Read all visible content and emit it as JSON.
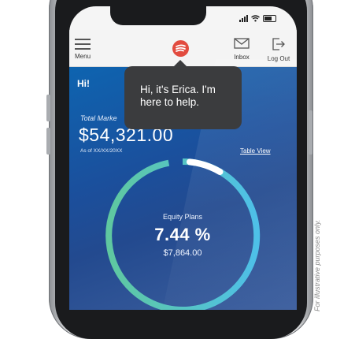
{
  "status_bar": {
    "icons": [
      "signal-icon",
      "wifi-icon",
      "battery-icon"
    ]
  },
  "app_bar": {
    "menu_label": "Menu",
    "inbox_label": "Inbox",
    "logout_label": "Log Out",
    "erica_icon": "erica-logo-icon"
  },
  "main": {
    "greeting": "Hi!",
    "total_label": "Total Marke",
    "amount": "$54,321.00",
    "as_of": "As of XX/XX/20XX",
    "table_view_link": "Table View"
  },
  "ring": {
    "label": "Equity Plans",
    "percent": "7.44 %",
    "amount": "$7,864.00"
  },
  "tooltip": {
    "message": "Hi, it's Erica. I'm here to help."
  },
  "disclaimer": "For illustrative purposes only.",
  "colors": {
    "accent_red": "#e24b3f",
    "background_blue": "#1b4f9c",
    "ring_green": "#5fc8a0",
    "ring_cyan": "#4ec0e8",
    "tooltip": "#3b3c3e"
  }
}
